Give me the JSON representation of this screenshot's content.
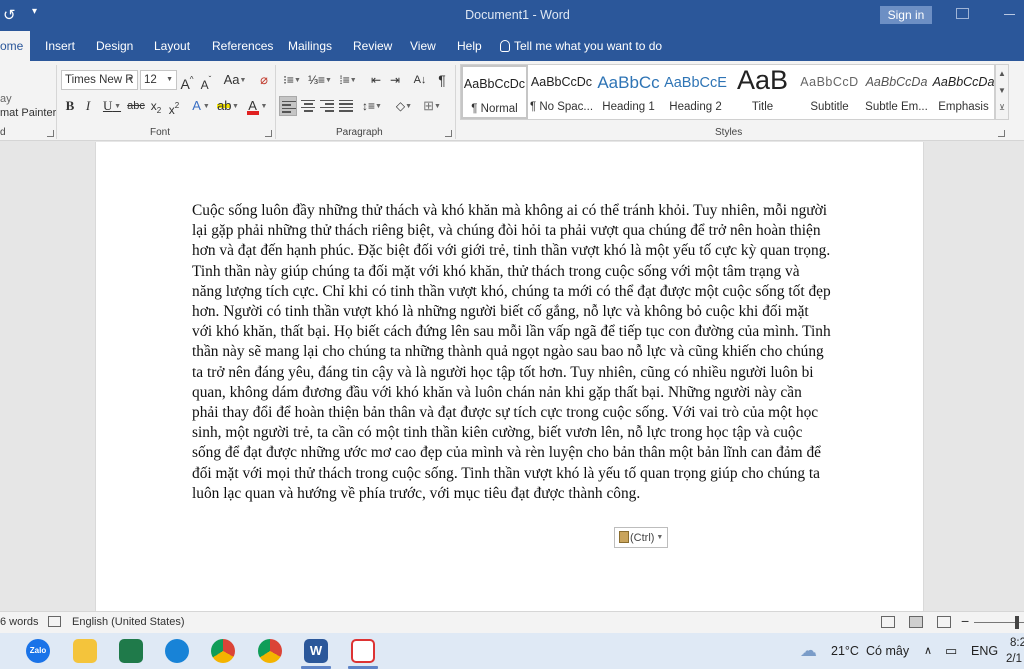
{
  "window": {
    "title": "Document1 - Word",
    "signin_label": "Sign in"
  },
  "tabs": [
    {
      "label": "ome"
    },
    {
      "label": "Insert"
    },
    {
      "label": "Design"
    },
    {
      "label": "Layout"
    },
    {
      "label": "References"
    },
    {
      "label": "Mailings"
    },
    {
      "label": "Review"
    },
    {
      "label": "View"
    },
    {
      "label": "Help"
    }
  ],
  "tell_me": "Tell me what you want to do",
  "ribbon": {
    "clipboard": {
      "format_painter": "mat Painter",
      "group_label": "d"
    },
    "font": {
      "name": "Times New R",
      "size": "12",
      "group_label": "Font",
      "change_case": "Aa"
    },
    "paragraph": {
      "group_label": "Paragraph"
    },
    "styles": {
      "group_label": "Styles",
      "items": [
        {
          "sample": "AaBbCcDc",
          "name": "¶ Normal"
        },
        {
          "sample": "AaBbCcDc",
          "name": "¶ No Spac..."
        },
        {
          "sample": "AaBbCc",
          "name": "Heading 1"
        },
        {
          "sample": "AaBbCcE",
          "name": "Heading 2"
        },
        {
          "sample": "AaB",
          "name": "Title"
        },
        {
          "sample": "AaBbCcD",
          "name": "Subtitle"
        },
        {
          "sample": "AaBbCcDa",
          "name": "Subtle Em..."
        },
        {
          "sample": "AaBbCcDa",
          "name": "Emphasis"
        }
      ]
    }
  },
  "document": {
    "text": "Cuộc sống luôn đầy những thử thách và khó khăn mà không ai có thể tránh khỏi. Tuy nhiên, mỗi người lại gặp phải những thử thách riêng biệt, và chúng đòi hỏi ta phải vượt qua chúng để trở nên hoàn thiện hơn và đạt đến hạnh phúc. Đặc biệt đối với giới trẻ, tinh thần vượt khó là một yếu tố cực kỳ quan trọng. Tinh thần này giúp chúng ta đối mặt với khó khăn, thử thách trong cuộc sống với một tâm trạng và năng lượng tích cực. Chỉ khi có tinh thần vượt khó, chúng ta mới có thể đạt được một cuộc sống tốt đẹp hơn. Người có tinh thần vượt khó là những người biết cố gắng, nỗ lực và không bỏ cuộc khi đối mặt với khó khăn, thất bại. Họ biết cách đứng lên sau mỗi lần vấp ngã để tiếp tục con đường của mình. Tinh thần này sẽ mang lại cho chúng ta những thành quả ngọt ngào sau bao nỗ lực và cũng khiến cho chúng ta trở nên đáng yêu, đáng tin cậy và là người học tập tốt hơn. Tuy nhiên, cũng có nhiều người luôn bi quan, không dám đương đầu với khó khăn và luôn chán nản khi gặp thất bại. Những người này cần phải thay đổi để hoàn thiện bản thân và đạt được sự tích cực trong cuộc sống. Với vai trò của một học sinh, một người trẻ, ta cần có một tinh thần kiên cường, biết vươn lên, nỗ lực trong học tập và cuộc sống để đạt được những ước mơ cao đẹp của mình và rèn luyện cho bản thân một bản lĩnh can đảm để đối mặt với mọi thử thách trong cuộc sống. Tinh thần vượt khó là yếu tố quan trọng giúp cho chúng ta luôn lạc quan và hướng về phía trước, với mục tiêu đạt được thành công.",
    "paste_options": "(Ctrl)"
  },
  "statusbar": {
    "word_count": "6 words",
    "language": "English (United States)"
  },
  "taskbar": {
    "zalo_label": "Zalo",
    "word_label": "W",
    "weather": "21°C",
    "weather_desc": "Có mây",
    "ime": "ENG",
    "time": "8:2",
    "date": "2/1"
  }
}
